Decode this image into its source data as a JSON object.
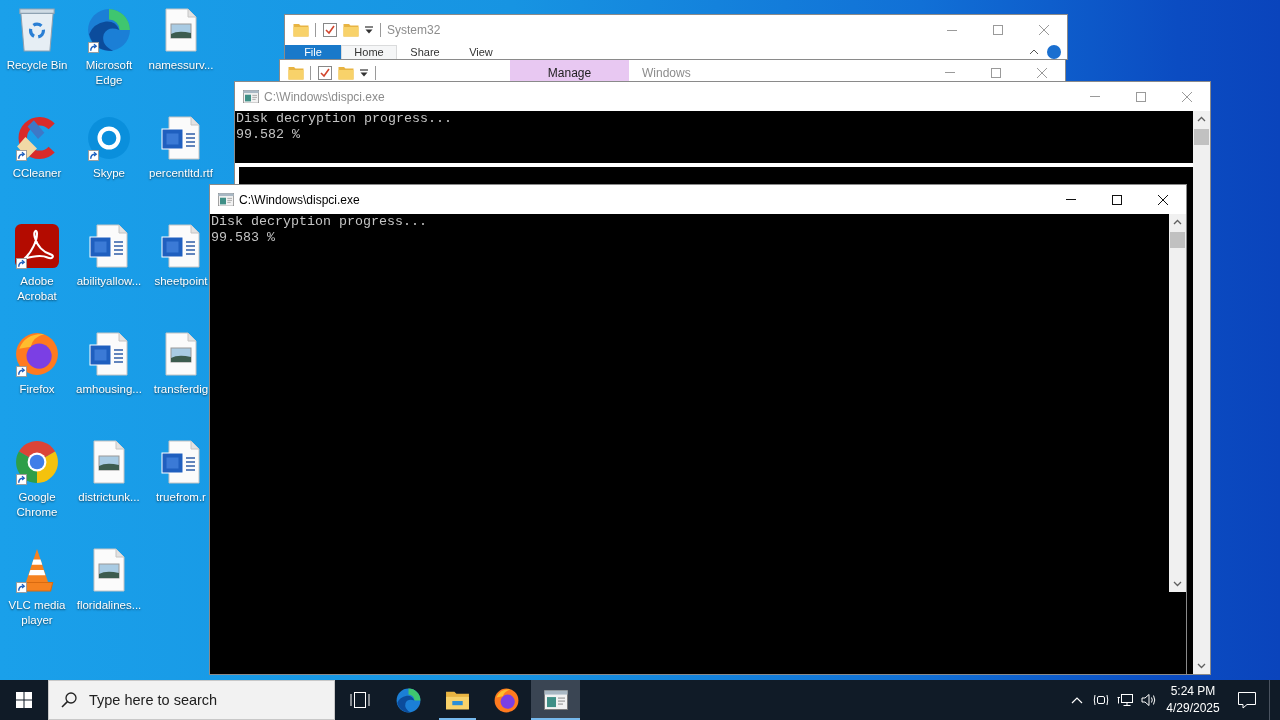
{
  "desktop_icons": [
    {
      "label": "Recycle Bin",
      "kind": "recycle-bin",
      "shortcut": false
    },
    {
      "label": "CCleaner",
      "kind": "ccleaner",
      "shortcut": true
    },
    {
      "label": "Adobe Acrobat",
      "kind": "acrobat",
      "shortcut": true
    },
    {
      "label": "Firefox",
      "kind": "firefox",
      "shortcut": true
    },
    {
      "label": "Google Chrome",
      "kind": "chrome",
      "shortcut": true
    },
    {
      "label": "VLC media player",
      "kind": "vlc",
      "shortcut": true
    },
    {
      "label": "Microsoft Edge",
      "kind": "edge",
      "shortcut": true
    },
    {
      "label": "Skype",
      "kind": "skype",
      "shortcut": true
    },
    {
      "label": "abilityallow...",
      "kind": "word-file",
      "shortcut": false
    },
    {
      "label": "amhousing...",
      "kind": "word-file",
      "shortcut": false
    },
    {
      "label": "districtunk...",
      "kind": "image-file",
      "shortcut": false
    },
    {
      "label": "floridalines...",
      "kind": "image-file",
      "shortcut": false
    },
    {
      "label": "namessurv...",
      "kind": "image-file",
      "shortcut": false
    },
    {
      "label": "percentltd.rtf",
      "kind": "word-file",
      "shortcut": false
    },
    {
      "label": "sheetpoint",
      "kind": "word-file",
      "shortcut": false
    },
    {
      "label": "transferdig",
      "kind": "image-file",
      "shortcut": false
    },
    {
      "label": "truefrom.r",
      "kind": "word-file",
      "shortcut": false
    }
  ],
  "windows": [
    {
      "kind": "explorer",
      "title": "System32",
      "active": false,
      "ribbon_tabs": [
        {
          "label": "File",
          "kind": "file",
          "selected": false
        },
        {
          "label": "Home",
          "kind": "tab",
          "selected": true
        },
        {
          "label": "Share",
          "kind": "tab",
          "selected": false
        },
        {
          "label": "View",
          "kind": "tab",
          "selected": false
        }
      ]
    },
    {
      "kind": "explorer",
      "title": "Windows",
      "active": false,
      "contextual_tab": "Manage"
    },
    {
      "kind": "console",
      "title": "C:\\Windows\\dispci.exe",
      "active": false,
      "lines": [
        "Disk decryption progress...",
        "99.582 %"
      ]
    },
    {
      "kind": "console",
      "title": "C:\\Windows\\dispci.exe",
      "active": true,
      "lines": [
        "Disk decryption progress...",
        "99.583 %"
      ]
    }
  ],
  "taskbar": {
    "search": {
      "placeholder": "Type here to search"
    },
    "apps": [
      {
        "kind": "edge",
        "running": false,
        "active": false
      },
      {
        "kind": "explorer",
        "running": true,
        "active": false
      },
      {
        "kind": "firefox",
        "running": false,
        "active": false
      },
      {
        "kind": "console",
        "running": true,
        "active": true
      }
    ],
    "clock": {
      "time": "5:24 PM",
      "date": "4/29/2025"
    }
  }
}
